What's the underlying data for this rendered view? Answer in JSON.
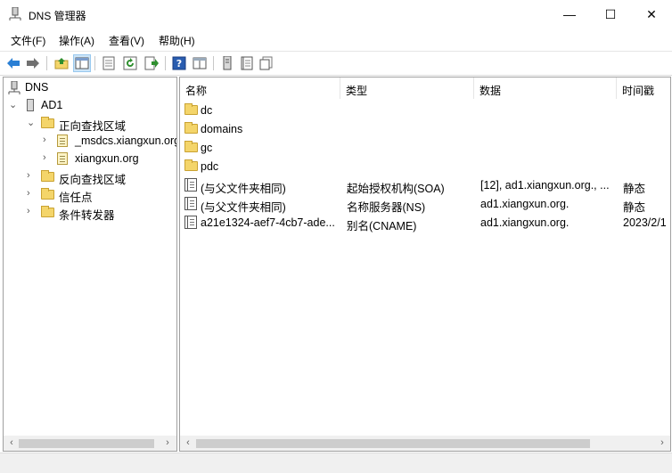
{
  "window": {
    "title": "DNS 管理器",
    "minimize": "—",
    "maximize": "☐",
    "close": "✕"
  },
  "menu": {
    "file": "文件(F)",
    "action": "操作(A)",
    "view": "查看(V)",
    "help": "帮助(H)"
  },
  "toolbar_icons": [
    "back-icon",
    "forward-icon",
    "up-folder-icon",
    "show-hide-tree-icon",
    "properties-icon",
    "refresh-icon",
    "export-list-icon",
    "help-icon",
    "view-icon",
    "server-icon",
    "records-icon",
    "copy-icon"
  ],
  "tree": {
    "root": "DNS",
    "server": "AD1",
    "forward_zones": "正向查找区域",
    "msdcs": "_msdcs.xiangxun.org",
    "xiangxun": "xiangxun.org",
    "reverse_zones": "反向查找区域",
    "trust_points": "信任点",
    "conditional_forwarders": "条件转发器"
  },
  "columns": {
    "name": "名称",
    "type": "类型",
    "data": "数据",
    "timestamp": "时间戳"
  },
  "rows": [
    {
      "name": "dc",
      "type": "",
      "data": "",
      "ts": "",
      "icon": "folder-icon"
    },
    {
      "name": "domains",
      "type": "",
      "data": "",
      "ts": "",
      "icon": "folder-icon"
    },
    {
      "name": "gc",
      "type": "",
      "data": "",
      "ts": "",
      "icon": "folder-icon"
    },
    {
      "name": "pdc",
      "type": "",
      "data": "",
      "ts": "",
      "icon": "folder-icon"
    },
    {
      "name": "(与父文件夹相同)",
      "type": "起始授权机构(SOA)",
      "data": "[12], ad1.xiangxun.org., ...",
      "ts": "静态",
      "icon": "record-icon"
    },
    {
      "name": "(与父文件夹相同)",
      "type": "名称服务器(NS)",
      "data": "ad1.xiangxun.org.",
      "ts": "静态",
      "icon": "record-icon"
    },
    {
      "name": "a21e1324-aef7-4cb7-ade...",
      "type": "别名(CNAME)",
      "data": "ad1.xiangxun.org.",
      "ts": "2023/2/1",
      "icon": "record-icon"
    }
  ],
  "scroll": {
    "left_arrow": "‹",
    "right_arrow": "›"
  },
  "colors": {
    "selection": "#d9d9d9",
    "toolbar_active": "#cce4f7",
    "folder": "#f4d56a"
  }
}
